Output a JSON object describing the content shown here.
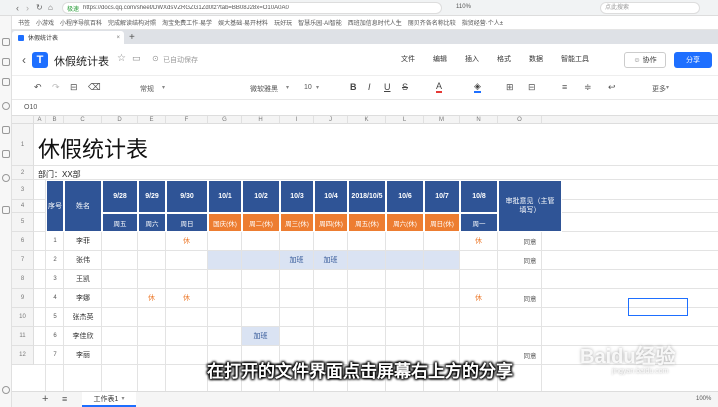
{
  "browser": {
    "secure_label": "极速",
    "url": "https://docs.qq.com/sheet/DWXdsVZRGZG1Zd0tz?tab=BB08J28x=O10A0A0",
    "zoom_label": "110%",
    "search_placeholder": "点此搜索",
    "bookmarks": [
      "书签",
      "小游戏",
      "小程序导航百科",
      "完成解读结构对照",
      "淘宝免费工作·易学",
      "娱大基础·易开材料",
      "玩好玩",
      "智慧乐园·AI智能",
      "西班加信息时代人生",
      "丽贝齐各名称比较",
      "指贸经营·个人±"
    ],
    "tab_title": "休假统计表"
  },
  "header": {
    "title": "休假统计表",
    "autosave": "已自动保存",
    "menu": [
      "文件",
      "编辑",
      "插入",
      "格式",
      "数据",
      "智能工具"
    ],
    "collab": "协作",
    "share": "分享"
  },
  "toolbar": {
    "style": "常规",
    "font": "微软雅黑",
    "size": "10",
    "more": "更多"
  },
  "formula": {
    "cell_ref": "O10"
  },
  "columns": [
    "A",
    "B",
    "C",
    "D",
    "E",
    "F",
    "G",
    "H",
    "I",
    "J",
    "K",
    "L",
    "M",
    "N",
    "O"
  ],
  "rows": [
    "1",
    "2",
    "3",
    "4",
    "5",
    "6",
    "7",
    "8",
    "9",
    "10",
    "11",
    "12"
  ],
  "sheet": {
    "title": "休假统计表",
    "dept": "部门：XX部",
    "h_seq": "序号",
    "h_name": "姓名",
    "h_review": "审批意见（主管填写）",
    "dates": [
      "9/28",
      "9/29",
      "9/30",
      "10/1",
      "10/2",
      "10/3",
      "10/4",
      "2018/10/5",
      "10/6",
      "10/7",
      "10/8"
    ],
    "weekdays": [
      "周五",
      "周六",
      "周日",
      "国庆(休)",
      "周二(休)",
      "周三(休)",
      "周四(休)",
      "周五(休)",
      "周六(休)",
      "周日(休)",
      "周一"
    ],
    "people": [
      {
        "seq": "1",
        "name": "李菲",
        "marks": [
          "",
          "",
          "休",
          "",
          "",
          "",
          "",
          "",
          "",
          "",
          "休"
        ],
        "review": "同意"
      },
      {
        "seq": "2",
        "name": "张伟",
        "marks": [
          "",
          "",
          "",
          "",
          "",
          "加班",
          "加班",
          "",
          "",
          "",
          ""
        ],
        "review": "同意"
      },
      {
        "seq": "3",
        "name": "王凯",
        "marks": [
          "",
          "",
          "",
          "",
          "",
          "",
          "",
          "",
          "",
          "",
          ""
        ],
        "review": ""
      },
      {
        "seq": "4",
        "name": "李娜",
        "marks": [
          "",
          "休",
          "休",
          "",
          "",
          "",
          "",
          "",
          "",
          "",
          "休"
        ],
        "review": "同意"
      },
      {
        "seq": "5",
        "name": "张杰英",
        "marks": [
          "",
          "",
          "",
          "",
          "",
          "",
          "",
          "",
          "",
          "",
          ""
        ],
        "review": ""
      },
      {
        "seq": "6",
        "name": "李佳欣",
        "marks": [
          "",
          "",
          "",
          "",
          "加班",
          "",
          "",
          "",
          "",
          "",
          ""
        ],
        "review": ""
      },
      {
        "seq": "7",
        "name": "李丽",
        "marks": [
          "",
          "",
          "",
          "",
          "",
          "",
          "",
          "",
          "",
          "",
          ""
        ],
        "review": "同意"
      }
    ]
  },
  "subtitle": "在打开的文件界面点击屏幕右上方的分享",
  "watermark": "Baidu经验",
  "watermark_url": "jingyan.baidu.com",
  "bottom": {
    "sheet_tab": "工作表1",
    "zoom": "100%"
  },
  "colors": {
    "accent": "#1e6fff",
    "header_blue": "#2f5496",
    "holiday_orange": "#ed7d31",
    "overtime_fill": "#dae3f3"
  }
}
